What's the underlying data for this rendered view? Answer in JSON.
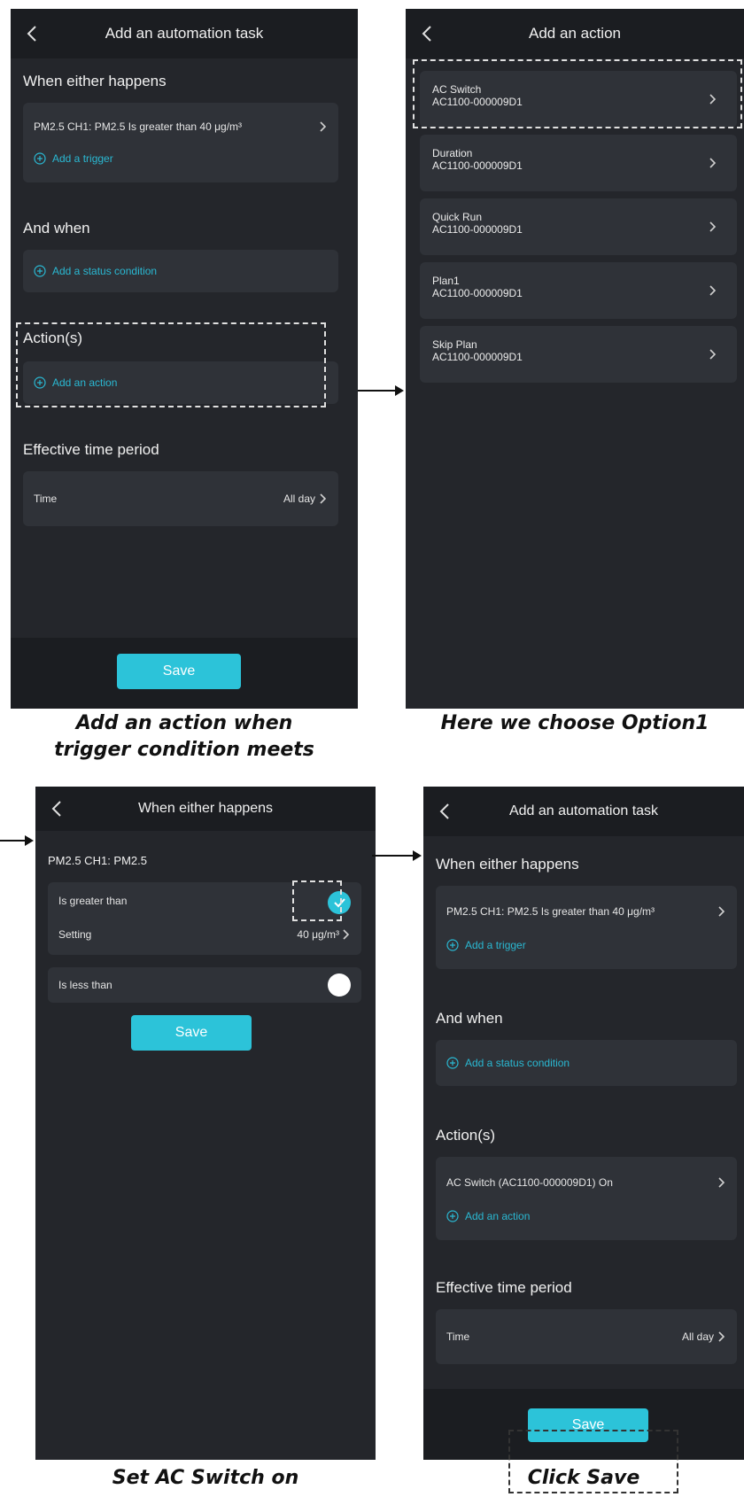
{
  "colors": {
    "background": "#24262b",
    "header": "#1b1d21",
    "card": "#2f3238",
    "accent": "#2ab8d2",
    "button": "#2cc3d9"
  },
  "icons": [
    "chevron-left-icon",
    "chevron-right-icon",
    "plus-circle-icon",
    "check-icon",
    "arrow-right-icon"
  ],
  "screen1": {
    "title": "Add an automation task",
    "when_label": "When either happens",
    "trigger_text": "PM2.5 CH1: PM2.5 Is greater than 40 μg/m³",
    "add_trigger": "Add a trigger",
    "and_when_label": "And when",
    "add_status": "Add a status condition",
    "actions_label": "Action(s)",
    "add_action": "Add an action",
    "effective_label": "Effective time period",
    "time_label": "Time",
    "time_value": "All day",
    "save": "Save"
  },
  "screen2": {
    "title": "Add an action",
    "items": [
      {
        "name": "AC Switch",
        "id": "AC1100-000009D1"
      },
      {
        "name": "Duration",
        "id": "AC1100-000009D1"
      },
      {
        "name": "Quick Run",
        "id": "AC1100-000009D1"
      },
      {
        "name": "Plan1",
        "id": "AC1100-000009D1"
      },
      {
        "name": "Skip Plan",
        "id": "AC1100-000009D1"
      }
    ]
  },
  "screen3": {
    "title": "When either happens",
    "sensor": "PM2.5 CH1: PM2.5",
    "greater_label": "Is greater than",
    "setting_label": "Setting",
    "setting_value": "40 μg/m³",
    "less_label": "Is less than",
    "save": "Save"
  },
  "screen4": {
    "title": "Add an automation task",
    "when_label": "When either happens",
    "trigger_text": "PM2.5 CH1: PM2.5 Is greater than 40 μg/m³",
    "add_trigger": "Add a trigger",
    "and_when_label": "And when",
    "add_status": "Add a status condition",
    "actions_label": "Action(s)",
    "action_text": "AC Switch (AC1100-000009D1) On",
    "add_action": "Add an action",
    "effective_label": "Effective time period",
    "time_label": "Time",
    "time_value": "All day",
    "save": "Save"
  },
  "captions": {
    "c1_line1": "Add an action when",
    "c1_line2": "trigger condition meets",
    "c2": "Here we choose Option1",
    "c3": "Set AC Switch on",
    "c4": "Click Save"
  }
}
